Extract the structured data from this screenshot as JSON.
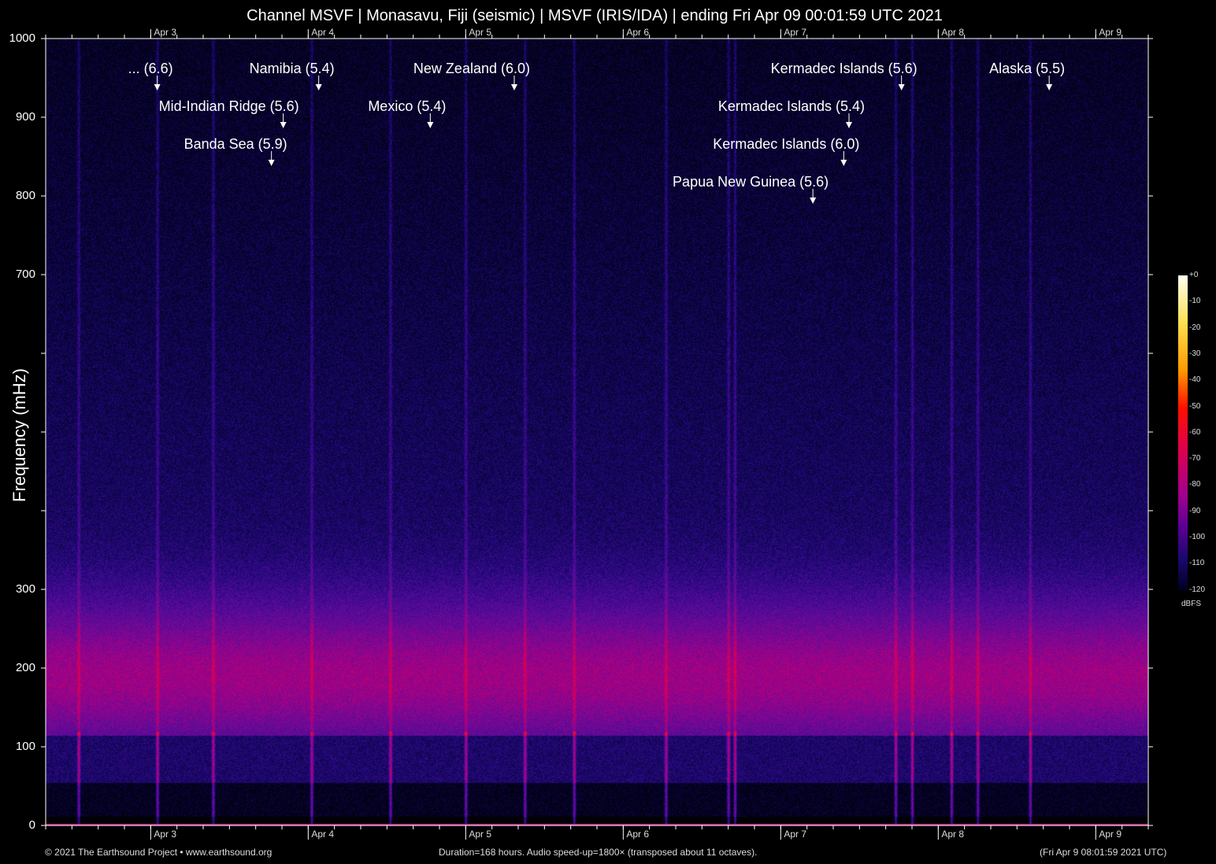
{
  "title": "Channel MSVF | Monasavu, Fiji (seismic) | MSVF (IRIS/IDA) | ending Fri Apr 09 00:01:59 UTC 2021",
  "footer": {
    "left": "© 2021 The Earthsound Project • www.earthsound.org",
    "center": "Duration=168 hours. Audio speed-up=1800× (transposed about 11 octaves).",
    "right": "(Fri Apr  9 08:01:59 2021 UTC)"
  },
  "colorbar": {
    "unit": "dBFS",
    "ticks": [
      "+0",
      "-10",
      "-20",
      "-30",
      "-40",
      "-50",
      "-60",
      "-70",
      "-80",
      "-90",
      "-100",
      "-110",
      "-120"
    ]
  },
  "chart_data": {
    "type": "heatmap",
    "title": "Channel MSVF | Monasavu, Fiji (seismic) | MSVF (IRIS/IDA) | ending Fri Apr 09 00:01:59 UTC 2021",
    "ylabel": "Frequency (mHz)",
    "ylim": [
      0,
      1000
    ],
    "xlim_hours": [
      0,
      168
    ],
    "y_ticks": [
      0,
      100,
      200,
      300,
      400,
      500,
      600,
      700,
      800,
      900,
      1000
    ],
    "y_tick_labels": [
      "0",
      "100",
      "200",
      "300",
      "",
      "",
      "",
      "700",
      "800",
      "900",
      "1000"
    ],
    "x_day_labels": [
      {
        "label": "Apr 3",
        "hour": 16
      },
      {
        "label": "Apr 4",
        "hour": 40
      },
      {
        "label": "Apr 5",
        "hour": 64
      },
      {
        "label": "Apr 6",
        "hour": 88
      },
      {
        "label": "Apr 7",
        "hour": 112
      },
      {
        "label": "Apr 8",
        "hour": 136
      },
      {
        "label": "Apr 9",
        "hour": 160
      }
    ],
    "color_range_dbfs": [
      -120,
      0
    ],
    "events": [
      {
        "label": "... (6.6)",
        "hour": 17.0,
        "row": 0
      },
      {
        "label": "Namibia (5.4)",
        "hour": 41.6,
        "row": 0
      },
      {
        "label": "New Zealand (6.0)",
        "hour": 71.4,
        "row": 0
      },
      {
        "label": "Kermadec Islands (5.6)",
        "hour": 130.4,
        "row": 0
      },
      {
        "label": "Alaska (5.5)",
        "hour": 152.9,
        "row": 0
      },
      {
        "label": "Mid-Indian Ridge (5.6)",
        "hour": 36.2,
        "row": 1
      },
      {
        "label": "Mexico (5.4)",
        "hour": 58.6,
        "row": 1
      },
      {
        "label": "Kermadec Islands (5.4)",
        "hour": 122.4,
        "row": 1
      },
      {
        "label": "Banda Sea (5.9)",
        "hour": 34.4,
        "row": 2
      },
      {
        "label": "Kermadec Islands (6.0)",
        "hour": 121.6,
        "row": 2
      },
      {
        "label": "Papua New Guinea (5.6)",
        "hour": 116.9,
        "row": 3
      }
    ],
    "noise_band_mhz": [
      120,
      260
    ],
    "streak_hours": [
      5,
      17,
      25.5,
      40.5,
      52.5,
      64,
      73,
      80.5,
      94.5,
      104,
      105,
      129.5,
      132,
      138,
      142,
      150
    ]
  }
}
